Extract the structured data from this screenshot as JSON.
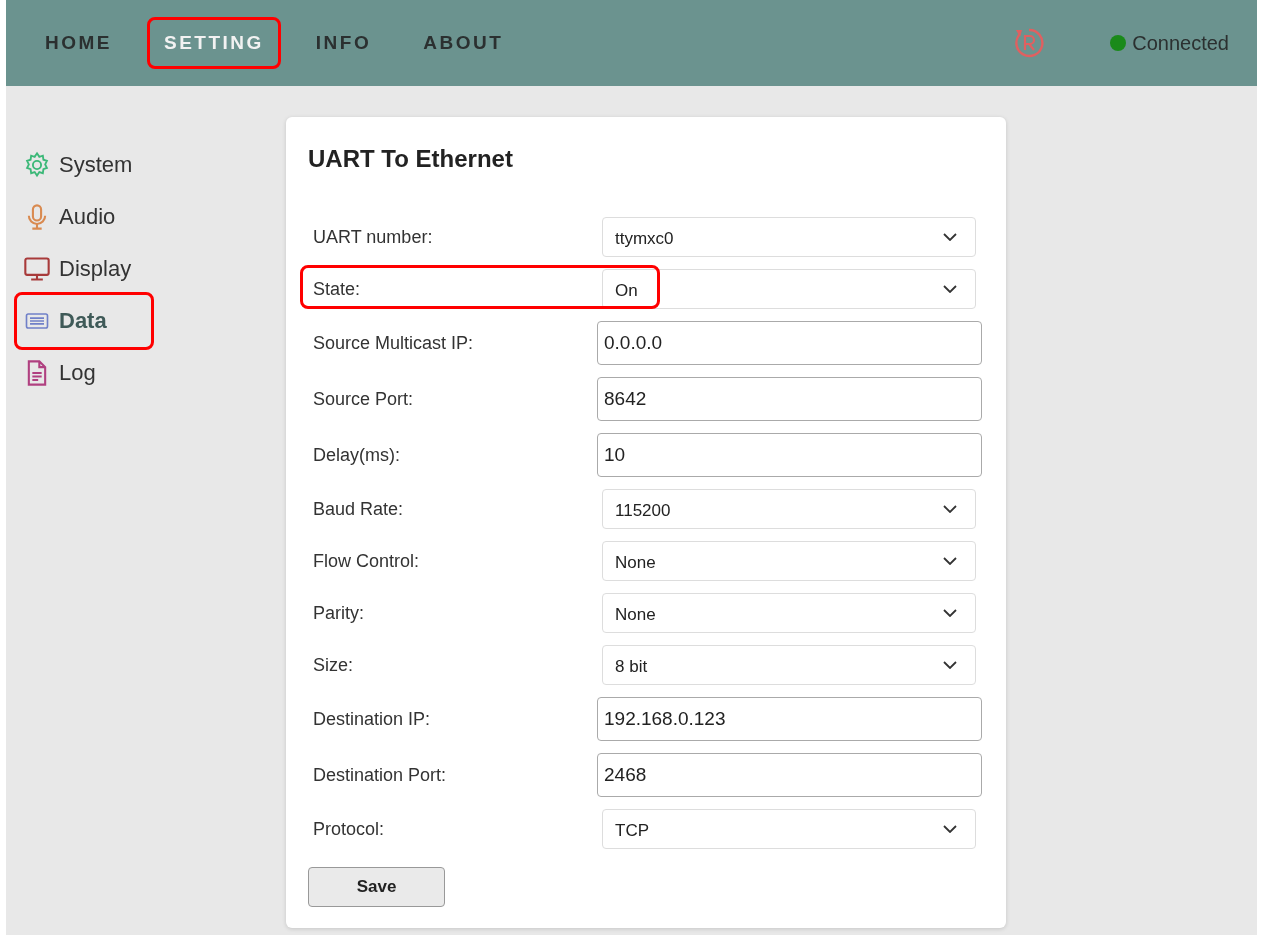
{
  "nav": {
    "tabs": [
      {
        "label": "HOME",
        "selected": false,
        "highlighted": false
      },
      {
        "label": "SETTING",
        "selected": true,
        "highlighted": true
      },
      {
        "label": "INFO",
        "selected": false,
        "highlighted": false
      },
      {
        "label": "ABOUT",
        "selected": false,
        "highlighted": false
      }
    ],
    "status": {
      "label": "Connected",
      "connected": true
    }
  },
  "sidebar": {
    "items": [
      {
        "label": "System",
        "kind": "gear",
        "color": "#3cb878",
        "selected": false,
        "highlighted": false
      },
      {
        "label": "Audio",
        "kind": "mic",
        "color": "#d98a50",
        "selected": false,
        "highlighted": false
      },
      {
        "label": "Display",
        "kind": "monitor",
        "color": "#a83a3a",
        "selected": false,
        "highlighted": false
      },
      {
        "label": "Data",
        "kind": "list",
        "color": "#7080c8",
        "selected": true,
        "highlighted": true
      },
      {
        "label": "Log",
        "kind": "doc",
        "color": "#b04080",
        "selected": false,
        "highlighted": false
      }
    ]
  },
  "form": {
    "title": "UART To Ethernet",
    "fields": [
      {
        "label": "UART number:",
        "kind": "select",
        "value": "ttymxc0",
        "highlighted": false
      },
      {
        "label": "State:",
        "kind": "select",
        "value": "On",
        "highlighted": true
      },
      {
        "label": "Source Multicast IP:",
        "kind": "input",
        "value": "0.0.0.0",
        "highlighted": false
      },
      {
        "label": "Source Port:",
        "kind": "input",
        "value": "8642",
        "highlighted": false
      },
      {
        "label": "Delay(ms):",
        "kind": "input",
        "value": "10",
        "highlighted": false
      },
      {
        "label": "Baud Rate:",
        "kind": "select",
        "value": "115200",
        "highlighted": false
      },
      {
        "label": "Flow Control:",
        "kind": "select",
        "value": "None",
        "highlighted": false
      },
      {
        "label": "Parity:",
        "kind": "select",
        "value": "None",
        "highlighted": false
      },
      {
        "label": "Size:",
        "kind": "select",
        "value": "8 bit",
        "highlighted": false
      },
      {
        "label": "Destination IP:",
        "kind": "input",
        "value": "192.168.0.123",
        "highlighted": false
      },
      {
        "label": "Destination Port:",
        "kind": "input",
        "value": "2468",
        "highlighted": false
      },
      {
        "label": "Protocol:",
        "kind": "select",
        "value": "TCP",
        "highlighted": false
      }
    ],
    "button": "Save"
  }
}
